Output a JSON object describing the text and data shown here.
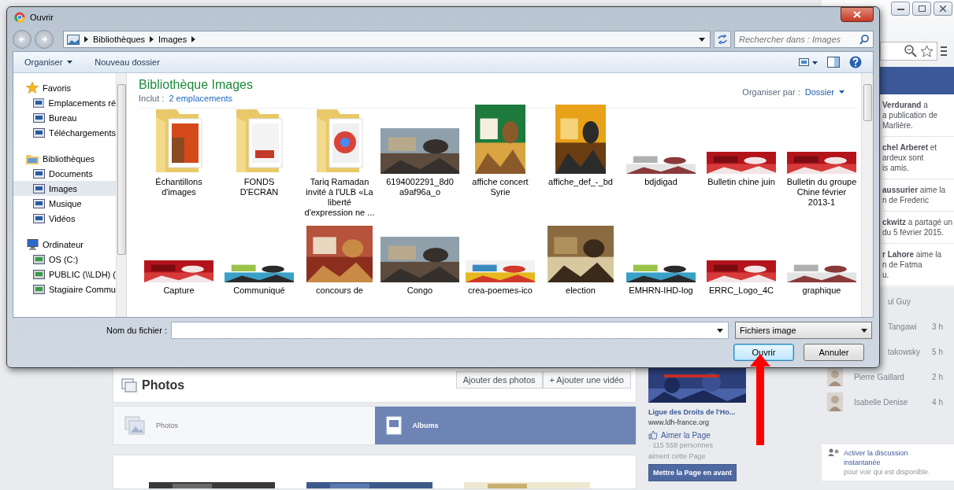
{
  "dialog": {
    "title": "Ouvrir",
    "breadcrumb": [
      "Bibliothèques",
      "Images"
    ],
    "search": {
      "placeholder": "Rechercher dans : Images"
    },
    "toolbar": {
      "organize": "Organiser",
      "new_folder": "Nouveau dossier"
    },
    "nav": [
      {
        "label": "Favoris",
        "children": [
          {
            "label": "Emplacements ré",
            "selected": false
          },
          {
            "label": "Bureau",
            "selected": false
          },
          {
            "label": "Téléchargements",
            "selected": false
          }
        ]
      },
      {
        "label": "Bibliothèques",
        "children": [
          {
            "label": "Documents",
            "selected": false
          },
          {
            "label": "Images",
            "selected": true
          },
          {
            "label": "Musique",
            "selected": false
          },
          {
            "label": "Vidéos",
            "selected": false
          }
        ]
      },
      {
        "label": "Ordinateur",
        "children": [
          {
            "label": "OS (C:)",
            "selected": false
          },
          {
            "label": "PUBLIC (\\\\LDH) (",
            "selected": false
          },
          {
            "label": "Stagiaire Commu",
            "selected": false
          }
        ]
      }
    ],
    "library": {
      "title": "Bibliothèque Images",
      "includes_label": "Inclut :",
      "includes_link": "2 emplacements",
      "arrange_label": "Organiser par :",
      "arrange_value": "Dossier"
    },
    "files": [
      {
        "name": "Échantillons d'images",
        "kind": "folder"
      },
      {
        "name": "FONDS D'ECRAN",
        "kind": "folder"
      },
      {
        "name": "Tariq Ramadan invité à l'ULB  «La liberté d'expression ne ...",
        "kind": "folder"
      },
      {
        "name": "6194002291_8d0a9af96a_o"
      },
      {
        "name": "affiche concert Syrie",
        "kind": "poster"
      },
      {
        "name": "affiche_def_-_bd",
        "kind": "poster"
      },
      {
        "name": "bdjdigad",
        "kind": "banner"
      },
      {
        "name": "Bulletin chine juin",
        "kind": "banner"
      },
      {
        "name": "Bulletin du groupe Chine février 2013-1",
        "kind": "banner"
      },
      {
        "name": "Capture",
        "kind": "banner"
      },
      {
        "name": "Communiqué",
        "kind": "banner"
      },
      {
        "name": "concours de",
        "kind": "tile"
      },
      {
        "name": "Congo"
      },
      {
        "name": "crea-poemes-ico",
        "kind": "banner"
      },
      {
        "name": "election",
        "kind": "tile"
      },
      {
        "name": "EMHRN-IHD-log",
        "kind": "banner"
      },
      {
        "name": "ERRC_Logo_4C",
        "kind": "banner"
      },
      {
        "name": "graphique",
        "kind": "banner"
      }
    ],
    "file_name_label": "Nom du fichier :",
    "file_type": "Fichiers image",
    "buttons": [
      {
        "label": "Ouvrir",
        "kind": "default"
      },
      {
        "label": "Annuler",
        "kind": "normal"
      }
    ]
  },
  "page": {
    "ticker": [
      {
        "lines": [
          "**Verdurand** a",
          "a publication de",
          "Marlière."
        ]
      },
      {
        "lines": [
          "**chel Arberet** et",
          "ardeux sont",
          "is amis."
        ]
      },
      {
        "lines": [
          "**aussurier** aime la",
          "n de Frederic"
        ]
      },
      {
        "lines": [
          "**ckwitz** a partagé un",
          "du 5 février 2015."
        ]
      },
      {
        "lines": [
          "**r Lahore** aime la",
          "n de Fatma",
          "u."
        ]
      }
    ],
    "chat_cut": [
      {
        "name": "ul Guy"
      },
      {
        "name": "Tangawi",
        "time": "3 h"
      },
      {
        "name": "takowsky",
        "time": "5 h"
      }
    ],
    "chat": [
      {
        "name": "Pierre Gaillard",
        "time": "2 h"
      },
      {
        "name": "Isabelle Denise",
        "time": "4 h"
      }
    ],
    "chat_prompt": {
      "link": "Activer la discussion instantanée",
      "text": "pour voir qui est disponible."
    },
    "suggested_page": {
      "name": "Ligue des Droits de l'Ho...",
      "url": "www.ldh-france.org",
      "like": "Aimer la Page",
      "likes": "· 115 558 personnes aiment cette Page",
      "promote": "Mettre la Page en avant"
    },
    "photos": {
      "title": "Photos",
      "actions": [
        "Ajouter des photos",
        "+ Ajouter une vidéo"
      ],
      "tabs": [
        {
          "label": "Photos",
          "selected": false
        },
        {
          "label": "Albums",
          "selected": true
        }
      ]
    }
  }
}
